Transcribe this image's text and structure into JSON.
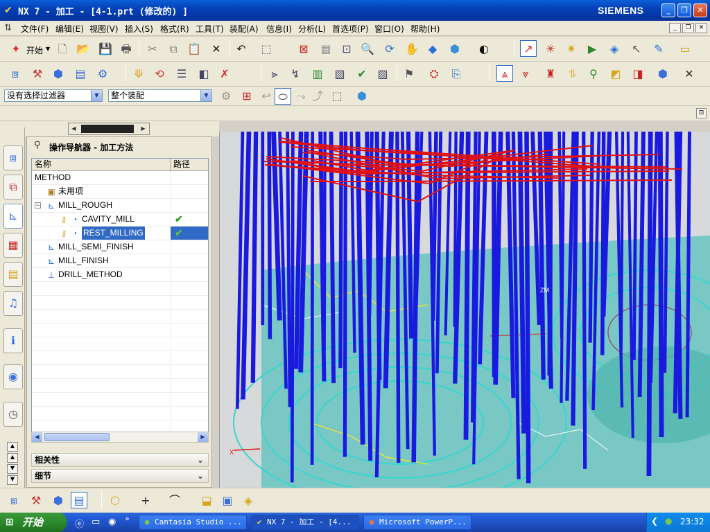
{
  "window": {
    "title": "NX 7 - 加工 - [4-1.prt  (修改的) ]",
    "brand": "SIEMENS"
  },
  "menu": [
    "文件(F)",
    "编辑(E)",
    "视图(V)",
    "插入(S)",
    "格式(R)",
    "工具(T)",
    "装配(A)",
    "信息(I)",
    "分析(L)",
    "首选项(P)",
    "窗口(O)",
    "帮助(H)"
  ],
  "toolbar": {
    "start_label": "开始",
    "filter_value": "没有选择过滤器",
    "scope_value": "整个装配"
  },
  "navigator": {
    "title": "操作导航器 - 加工方法",
    "col_name": "名称",
    "col_path": "路径",
    "rows": [
      {
        "label": "METHOD"
      },
      {
        "label": "未用项"
      },
      {
        "label": "MILL_ROUGH"
      },
      {
        "label": "CAVITY_MILL",
        "path": "✔"
      },
      {
        "label": "REST_MILLING",
        "path": "✔"
      },
      {
        "label": "MILL_SEMI_FINISH"
      },
      {
        "label": "MILL_FINISH"
      },
      {
        "label": "DRILL_METHOD"
      }
    ],
    "panel_dependencies": "相关性",
    "panel_details": "细节"
  },
  "viewport": {
    "label_zm": "ZM",
    "label_x": "X"
  },
  "taskbar": {
    "start": "开始",
    "items": [
      "Cantasia Studio ...",
      "NX 7 - 加工 - [4...",
      "Microsoft PowerP..."
    ],
    "clock": "23:32"
  },
  "colors": {
    "toolpath": "#1a1adf",
    "rapid": "#e01010",
    "cut_pattern": "#38d6cf",
    "selection": "#316ac5",
    "title_bar": "#0a5fd8"
  }
}
